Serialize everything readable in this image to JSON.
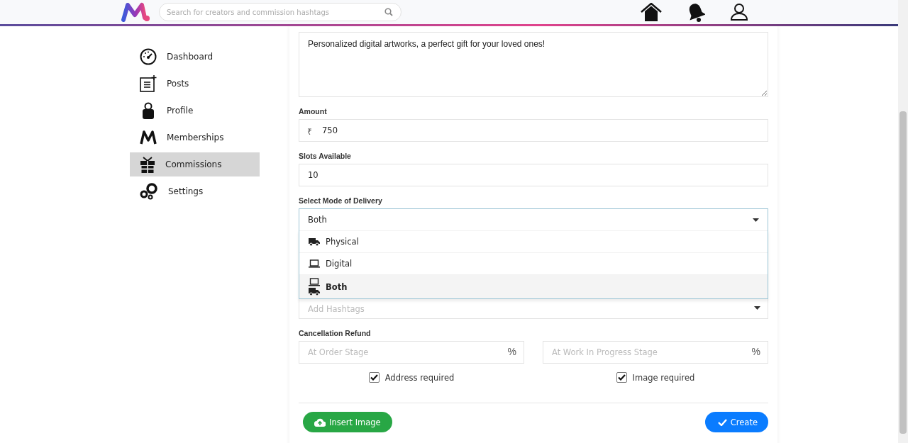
{
  "header": {
    "search": {
      "placeholder": "Search for creators and commission hashtags"
    }
  },
  "sidebar": {
    "items": [
      {
        "label": "Dashboard",
        "kind": "dashboard",
        "selected": false
      },
      {
        "label": "Posts",
        "kind": "posts",
        "selected": false
      },
      {
        "label": "Profile",
        "kind": "profile",
        "selected": false
      },
      {
        "label": "Memberships",
        "kind": "memberships",
        "selected": false
      },
      {
        "label": "Commissions",
        "kind": "commissions",
        "selected": true
      },
      {
        "label": "Settings",
        "kind": "settings",
        "selected": false
      }
    ]
  },
  "form": {
    "description": {
      "value": "Personalized digital artworks, a perfect gift for your loved ones!"
    },
    "amount": {
      "label": "Amount",
      "currency": "₹",
      "value": "750"
    },
    "slots": {
      "label": "Slots Available",
      "value": "10"
    },
    "delivery": {
      "label": "Select Mode of Delivery",
      "value": "Both",
      "options": [
        {
          "label": "Physical",
          "kind": "truck",
          "selected": false
        },
        {
          "label": "Digital",
          "kind": "laptop",
          "selected": false
        },
        {
          "label": "Both",
          "kind": "both",
          "selected": true
        }
      ]
    },
    "hashtags": {
      "placeholder": "Add Hashtags"
    },
    "refund": {
      "label": "Cancellation Refund",
      "fields": [
        {
          "placeholder": "At Order Stage",
          "unit": "%"
        },
        {
          "placeholder": "At Work In Progress Stage",
          "unit": "%"
        }
      ]
    },
    "checkboxes": [
      {
        "label": "Address required",
        "checked": true
      },
      {
        "label": "Image required",
        "checked": true
      }
    ],
    "buttons": {
      "insert": "Insert Image",
      "create": "Create"
    }
  }
}
